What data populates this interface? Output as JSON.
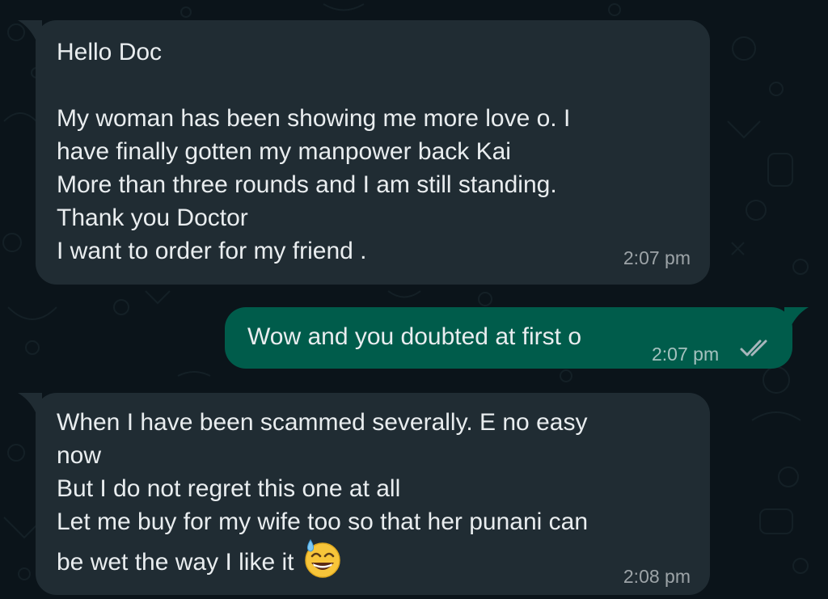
{
  "messages": [
    {
      "direction": "incoming",
      "lines": [
        "Hello Doc",
        "",
        "My woman has been showing me more love o. I",
        "have finally gotten my manpower back Kai",
        "More than three rounds and I am still standing.",
        "Thank you Doctor",
        "I want to order for my friend ."
      ],
      "time": "2:07 pm"
    },
    {
      "direction": "outgoing",
      "lines": [
        "Wow and you doubted at first o"
      ],
      "time": "2:07 pm",
      "status": "read"
    },
    {
      "direction": "incoming",
      "lines": [
        "When I have been scammed severally. E no easy",
        "now",
        "But I do not regret this one at all",
        "Let me buy for my wife too so that her punani can",
        "be wet the way I like it"
      ],
      "emoji": "grinning-face-with-sweat",
      "time": "2:08 pm"
    }
  ],
  "colors": {
    "background": "#0b141a",
    "incoming_bubble": "#202c33",
    "outgoing_bubble": "#005c4b",
    "text": "#e9edef",
    "read_ticks": "#8696a0"
  }
}
